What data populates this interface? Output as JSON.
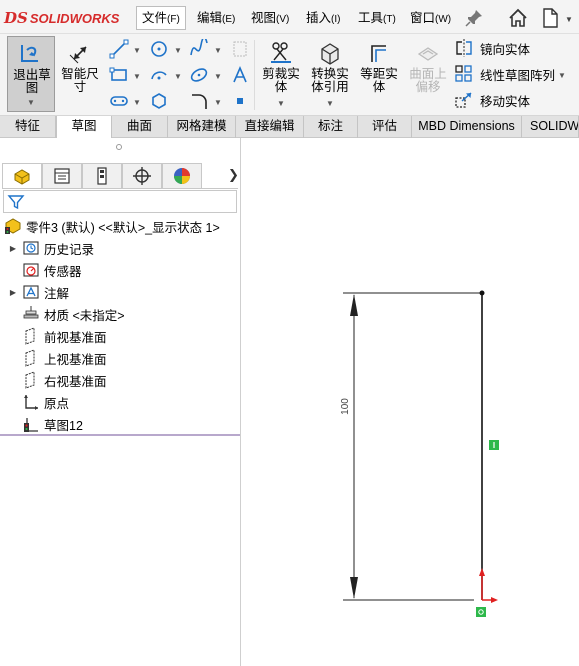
{
  "app": {
    "logo_ds": "DS",
    "logo_solid": "SOLID",
    "logo_works": "WORKS"
  },
  "menu": [
    {
      "label": "文件",
      "accel": "(F)"
    },
    {
      "label": "编辑",
      "accel": "(E)"
    },
    {
      "label": "视图",
      "accel": "(V)"
    },
    {
      "label": "插入",
      "accel": "(I)"
    },
    {
      "label": "工具",
      "accel": "(T)"
    },
    {
      "label": "窗口",
      "accel": "(W)"
    }
  ],
  "ribbon": {
    "exit_sketch": "退出草图",
    "smart_dimension": "智能尺寸",
    "trim_entities": "剪裁实体",
    "convert_entities": "转换实体引用",
    "offset_entities": "等距实体",
    "offset_on_surface": "曲面上偏移",
    "mirror_entities": "镜向实体",
    "linear_pattern": "线性草图阵列",
    "move_entities": "移动实体"
  },
  "tabs": [
    "特征",
    "草图",
    "曲面",
    "网格建模",
    "直接编辑",
    "标注",
    "评估",
    "MBD Dimensions",
    "SOLIDWORKS"
  ],
  "tree": {
    "root": "零件3 (默认) <<默认>_显示状态 1>",
    "items": [
      {
        "label": "历史记录",
        "expandable": true,
        "icon": "history-icon"
      },
      {
        "label": "传感器",
        "expandable": false,
        "icon": "sensor-icon"
      },
      {
        "label": "注解",
        "expandable": true,
        "icon": "annotation-icon"
      },
      {
        "label": "材质 <未指定>",
        "expandable": false,
        "icon": "material-icon"
      },
      {
        "label": "前视基准面",
        "expandable": false,
        "icon": "plane-icon"
      },
      {
        "label": "上视基准面",
        "expandable": false,
        "icon": "plane-icon"
      },
      {
        "label": "右视基准面",
        "expandable": false,
        "icon": "plane-icon"
      },
      {
        "label": "原点",
        "expandable": false,
        "icon": "origin-icon"
      },
      {
        "label": "草图12",
        "expandable": false,
        "icon": "sketch-icon"
      }
    ]
  },
  "graphics": {
    "dimension_value": "100"
  },
  "colors": {
    "logo_red": "#d62b2b",
    "relation_green": "#2db84a",
    "origin_red": "#e02020",
    "rollback_bar": "#b8a8cc"
  }
}
